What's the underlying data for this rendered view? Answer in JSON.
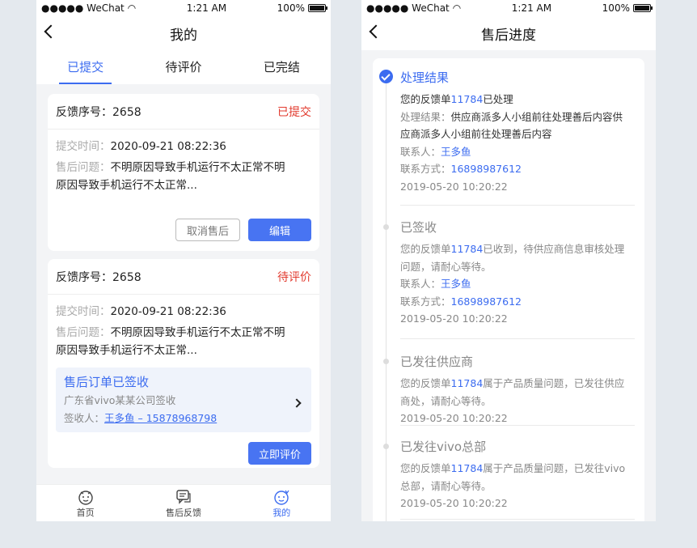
{
  "status": {
    "carrier": "●●●●● WeChat",
    "time": "1:21 AM",
    "battery": "100%"
  },
  "left": {
    "title": "我的",
    "tabs": [
      "已提交",
      "待评价",
      "已完结"
    ],
    "cards": [
      {
        "number": "反馈序号：2658",
        "status": "已提交",
        "time_label": "提交时间：",
        "time": "2020-09-21   08:22:36",
        "issue_label": "售后问题：",
        "issue_line1": "不明原因导致手机运行不太正常不明",
        "issue_line2": "原因导致手机运行不太正常...",
        "cancel_label": "取消售后",
        "edit_label": "编辑"
      },
      {
        "number": "反馈序号：2658",
        "status": "待评价",
        "time_label": "提交时间：",
        "time": "2020-09-21   08:22:36",
        "issue_label": "售后问题：",
        "issue_line1": "不明原因导致手机运行不太正常不明",
        "issue_line2": "原因导致手机运行不太正常...",
        "sign_title": "售后订单已签收",
        "sign_company": "广东省vivo某某公司签收",
        "receiver_label": "签收人：",
        "receiver": "王多鱼 – 15878968798",
        "rate_label": "立即评价"
      }
    ],
    "tabbar": [
      {
        "label": "首页",
        "icon": "home-face-icon"
      },
      {
        "label": "售后反馈",
        "icon": "feedback-chat-icon"
      },
      {
        "label": "我的",
        "icon": "profile-face-icon"
      }
    ]
  },
  "right": {
    "title": "售后进度",
    "steps": [
      {
        "title": "处理结果",
        "line1_pre": "您的反馈单",
        "order": "11784",
        "line1_post": "已处理",
        "result_label": "处理结果：",
        "result_a": "供应商派多人小组前往处理善后内容供",
        "result_b": "应商派多人小组前往处理善后内容",
        "contact_label": "联系人：",
        "contact": "王多鱼",
        "phone_label": "联系方式：",
        "phone": "16898987612",
        "time": "2019-05-20   10:20:22"
      },
      {
        "title": "已签收",
        "line1_pre": "您的反馈单",
        "order": "11784",
        "line1_post": "已收到，待供应商信息审核处理",
        "line2": "问题，请耐心等待。",
        "contact_label": "联系人：",
        "contact": "王多鱼",
        "phone_label": "联系方式：",
        "phone": "16898987612",
        "time": "2019-05-20   10:20:22"
      },
      {
        "title": "已发往供应商",
        "line1_pre": "您的反馈单",
        "order": "11784",
        "line1_post": "属于产品质量问题，已发往供应",
        "line2": "商处，请耐心等待。",
        "time": "2019-05-20   10:20:22"
      },
      {
        "title": "已发往vivo总部",
        "line1_pre": "您的反馈单",
        "order": "11784",
        "line1_post": "属于产品质量问题，已发往vivo",
        "line2": "总部，请耐心等待。",
        "time": "2019-05-20   10:20:22"
      }
    ]
  },
  "colors": {
    "accent": "#3c6cf0",
    "alert": "#e23a2e",
    "background": "#e4e9ee"
  }
}
